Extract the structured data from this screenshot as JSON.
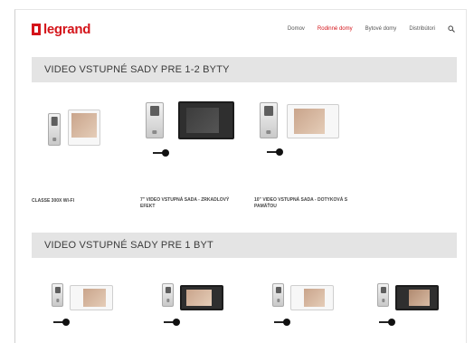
{
  "brand": {
    "name": "legrand",
    "color": "#d4141a"
  },
  "nav": {
    "items": [
      {
        "label": "Domov",
        "active": false
      },
      {
        "label": "Rodinné domy",
        "active": true
      },
      {
        "label": "Bytové domy",
        "active": false
      },
      {
        "label": "Distribútori",
        "active": false
      }
    ],
    "search_icon": "search-icon"
  },
  "sections": [
    {
      "title": "VIDEO VSTUPNÉ SADY PRE 1-2 BYTY",
      "products": [
        {
          "caption": "CLASSE 300X WI-FI"
        },
        {
          "caption": "7\" VIDEO VSTUPNÁ SADA - ZRKADLOVÝ EFEKT"
        },
        {
          "caption": "10\" VIDEO VSTUPNÁ SADA - DOTYKOVÁ S PAMÄŤOU"
        }
      ]
    },
    {
      "title": "VIDEO VSTUPNÉ SADY PRE 1 BYT",
      "products": []
    }
  ],
  "colors": {
    "section_bar": "#e4e4e4",
    "accent": "#d4141a"
  }
}
